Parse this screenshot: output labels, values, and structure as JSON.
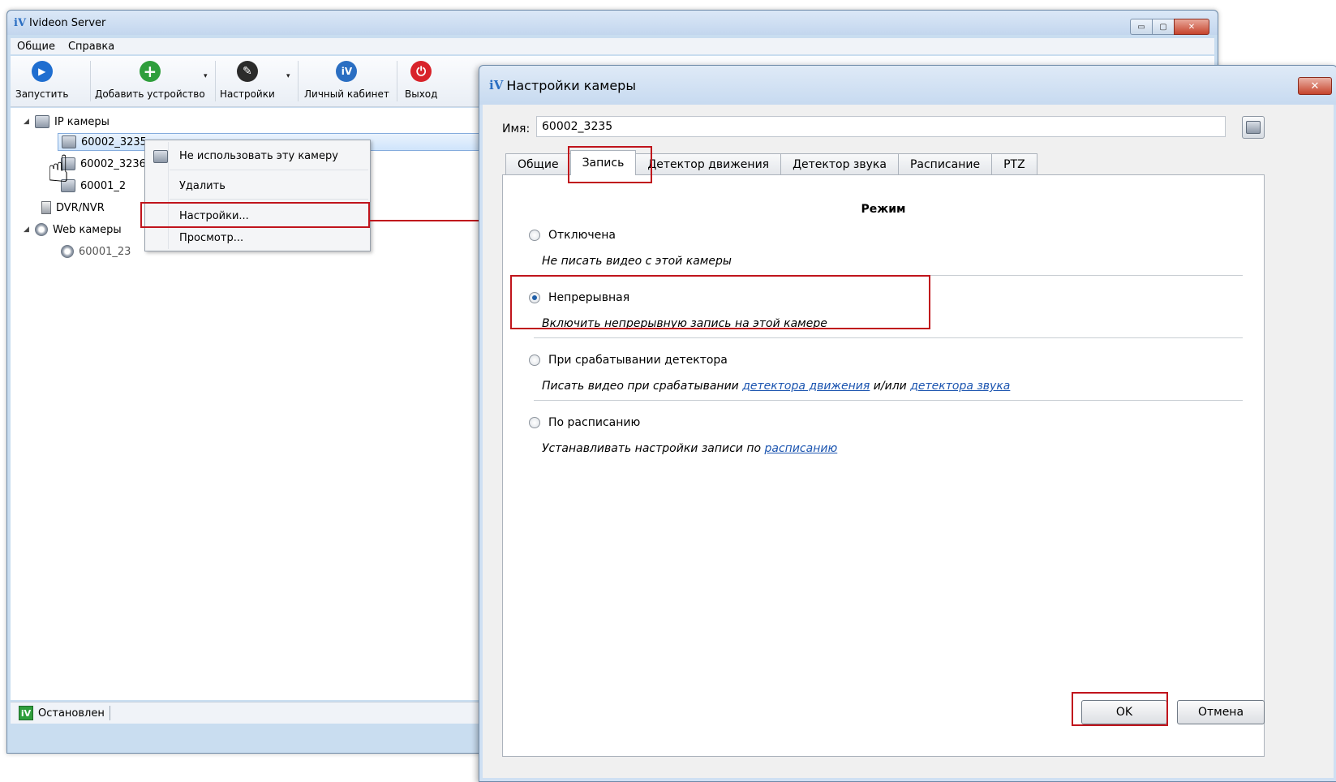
{
  "main_window": {
    "logo": "iV",
    "title": "Ivideon Server",
    "controls": {
      "minimize": "▭",
      "maximize": "▢",
      "close": "✕"
    }
  },
  "menu": [
    "Общие",
    "Справка"
  ],
  "toolbar": {
    "start": "Запустить",
    "add_device": "Добавить устройство",
    "settings": "Настройки",
    "cabinet": "Личный кабинет",
    "exit": "Выход",
    "icons": {
      "start": "▶",
      "add": "+",
      "settings": "✎",
      "cabinet": "iV",
      "exit": "⏻"
    },
    "dropdown_arrow": "▾"
  },
  "tree": {
    "ip_cameras": "IP камеры",
    "cam1": "60002_3235",
    "cam2": "60002_3236",
    "cam3": "60001_2",
    "dvr": "DVR/NVR",
    "web_cameras": "Web камеры",
    "web_cam1": "60001_23",
    "expander": "◢"
  },
  "context_menu": {
    "dont_use": "Не использовать эту камеру",
    "delete": "Удалить",
    "settings": "Настройки...",
    "view": "Просмотр..."
  },
  "status": {
    "logo": "iV",
    "text": "Остановлен"
  },
  "dialog": {
    "logo": "iV",
    "title": "Настройки камеры",
    "close": "✕",
    "name_label": "Имя:",
    "name_value": "60002_3235",
    "tabs": [
      "Общие",
      "Запись",
      "Детектор движения",
      "Детектор звука",
      "Расписание",
      "PTZ"
    ],
    "section_title": "Режим",
    "options": {
      "off": {
        "label": "Отключена",
        "desc": "Не писать видео с этой камеры"
      },
      "continuous": {
        "label": "Непрерывная",
        "desc": "Включить непрерывную запись на этой камере"
      },
      "detector": {
        "label": "При срабатывании детектора",
        "desc_pre": "Писать видео при срабатывании ",
        "link1": "детектора движения",
        "desc_mid": " и/или ",
        "link2": "детектора звука"
      },
      "schedule": {
        "label": "По расписанию",
        "desc_pre": "Устанавливать настройки записи по ",
        "link": "расписанию"
      }
    },
    "selected_option": "continuous",
    "ok": "OK",
    "cancel": "Отмена"
  },
  "colors": {
    "highlight": "#c0141c",
    "link": "#1c55b0",
    "accent": "#1f5fa8"
  }
}
